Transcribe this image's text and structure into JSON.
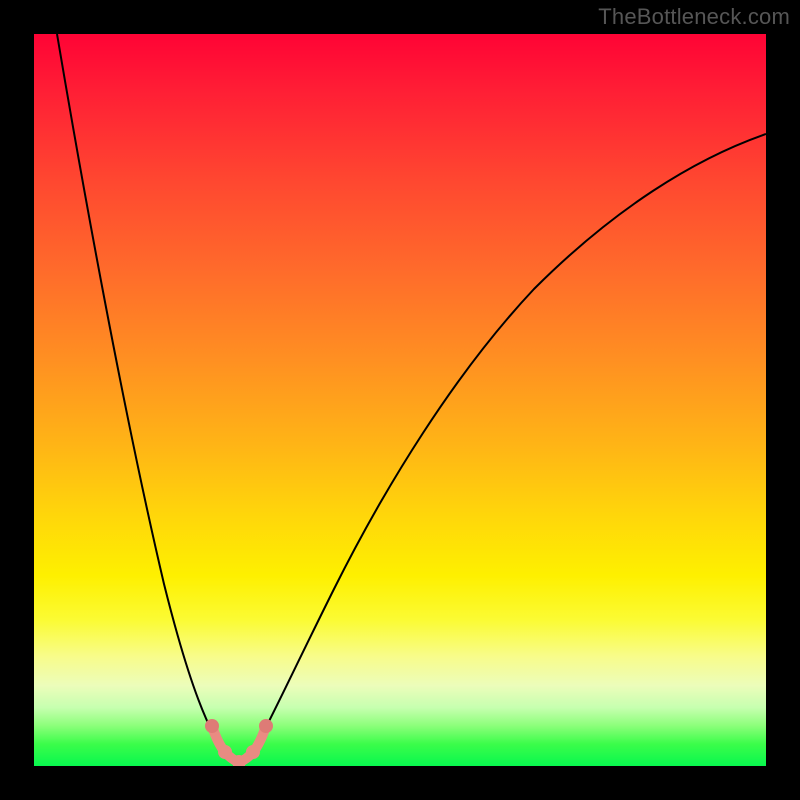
{
  "watermark": "TheBottleneck.com",
  "chart_data": {
    "type": "line",
    "title": "",
    "xlabel": "",
    "ylabel": "",
    "xlim": [
      0,
      100
    ],
    "ylim": [
      0,
      100
    ],
    "background": {
      "style": "vertical-gradient",
      "stops": [
        {
          "pos": 0,
          "color": "#ff0335"
        },
        {
          "pos": 20,
          "color": "#ff4730"
        },
        {
          "pos": 44,
          "color": "#ff8e22"
        },
        {
          "pos": 66,
          "color": "#ffd70a"
        },
        {
          "pos": 85,
          "color": "#f8fc8a"
        },
        {
          "pos": 100,
          "color": "#08f74e"
        }
      ]
    },
    "series": [
      {
        "name": "left_branch",
        "color": "#000000",
        "x": [
          3,
          7,
          12,
          18,
          24,
          27
        ],
        "y": [
          100,
          70,
          40,
          18,
          5,
          1
        ]
      },
      {
        "name": "right_branch",
        "color": "#000000",
        "x": [
          29,
          35,
          45,
          60,
          80,
          100
        ],
        "y": [
          1,
          8,
          28,
          55,
          78,
          86
        ]
      },
      {
        "name": "optimal_zone",
        "color": "#e98b82",
        "style": "beaded",
        "x": [
          24,
          26,
          28,
          30,
          32
        ],
        "y": [
          5.5,
          2.0,
          0.5,
          2.0,
          5.5
        ]
      }
    ],
    "annotations": [
      {
        "text": "TheBottleneck.com",
        "role": "watermark",
        "position": "top-right",
        "color": "#565656"
      }
    ]
  }
}
